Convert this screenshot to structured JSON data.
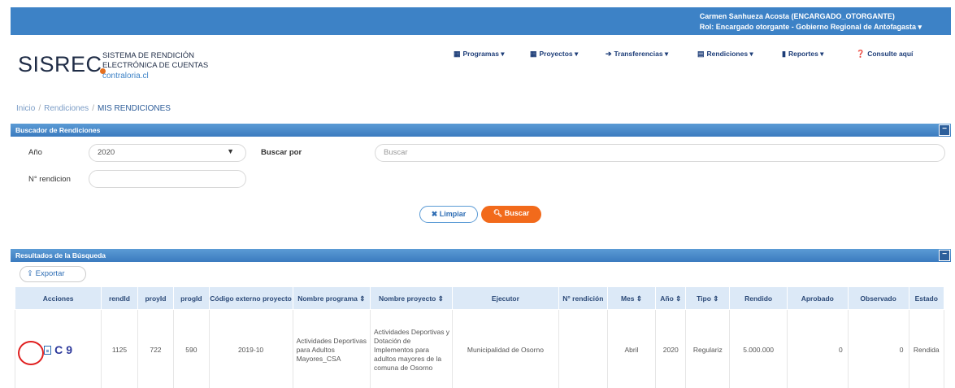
{
  "topbar": {
    "user_line": "Carmen Sanhueza Acosta (ENCARGADO_OTORGANTE)",
    "role_line": "Rol: Encargado otorgante - Gobierno Regional de Antofagasta ▾"
  },
  "logo": {
    "name": "SISREC",
    "line1": "SISTEMA DE RENDICIÓN",
    "line2": "ELECTRÓNICA DE CUENTAS",
    "domain": "contraloria.cl"
  },
  "nav": {
    "programas": "Programas ▾",
    "proyectos": "Proyectos ▾",
    "transferencias": "Transferencias ▾",
    "rendiciones": "Rendiciones ▾",
    "reportes": "Reportes ▾",
    "consulte": "Consulte aquí"
  },
  "breadcrumb": {
    "inicio": "Inicio",
    "rendiciones": "Rendiciones",
    "current": "MIS RENDICIONES"
  },
  "search_panel": {
    "title": "Buscador de Rendiciones",
    "year_label": "Año",
    "year_value": "2020",
    "search_by_label": "Buscar por",
    "search_placeholder": "Buscar",
    "rendicion_label": "N° rendicion",
    "clear_label": "Limpiar",
    "search_label": "Buscar"
  },
  "results_panel": {
    "title": "Resultados de la Búsqueda",
    "export_label": "Exportar",
    "columns": [
      "Acciones",
      "rendId",
      "proyId",
      "progId",
      "Código externo proyecto",
      "Nombre programa ⇕",
      "Nombre proyecto ⇕",
      "Ejecutor",
      "N° rendición",
      "Mes ⇕",
      "Año ⇕",
      "Tipo ⇕",
      "Rendido",
      "Aprobado",
      "Observado",
      "Estado"
    ],
    "row": {
      "rendId": "1125",
      "proyId": "722",
      "progId": "590",
      "codigo": "2019-10",
      "programa": "Actividades Deportivas para Adultos Mayores_CSA",
      "proyecto": "Actividades Deportivas y Dotación de Implementos para adultos mayores de la comuna de Osorno",
      "ejecutor": "Municipalidad de Osorno",
      "n_rendicion": "",
      "mes": "Abril",
      "anio": "2020",
      "tipo": "Regulariz",
      "rendido": "5.000.000",
      "aprobado": "0",
      "observado": "0",
      "estado": "Rendida"
    }
  },
  "colors": {
    "topbar": "#3d82c6",
    "accent_orange": "#f26a1b",
    "panel_header": "#4a8ccb"
  }
}
